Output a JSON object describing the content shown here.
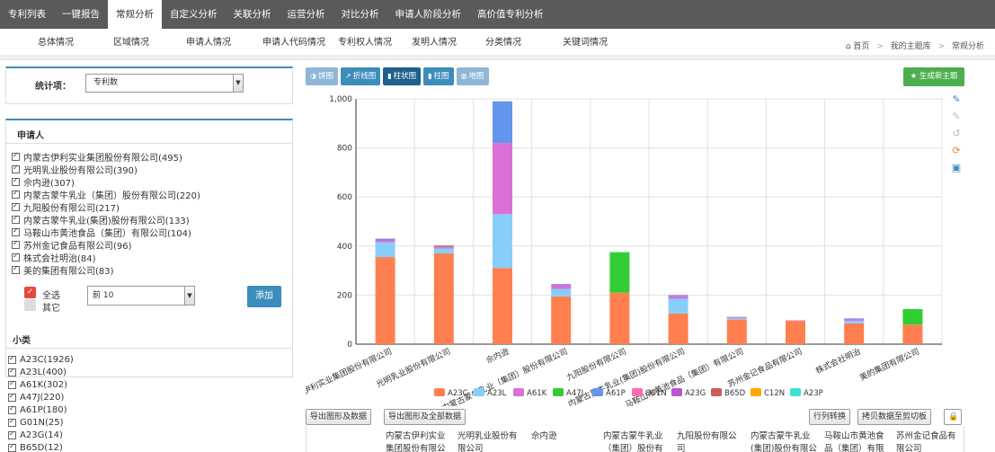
{
  "topnav": {
    "tabs": [
      {
        "label": "专利列表"
      },
      {
        "label": "一键报告"
      },
      {
        "label": "常规分析",
        "active": true
      },
      {
        "label": "自定义分析"
      },
      {
        "label": "关联分析"
      },
      {
        "label": "运营分析"
      },
      {
        "label": "对比分析"
      },
      {
        "label": "申请人阶段分析"
      },
      {
        "label": "高价值专利分析"
      }
    ]
  },
  "subnav": {
    "items": [
      "总体情况",
      "区域情况",
      "申请人情况",
      "申请人代码情况",
      "专利权人情况",
      "发明人情况",
      "分类情况",
      "关键词情况"
    ]
  },
  "breadcrumb": {
    "home": "首页",
    "library": "我的主题库",
    "current": "常规分析"
  },
  "left": {
    "stat_label": "统计项：",
    "stat_value": "专利数",
    "applicant_title": "申请人",
    "applicants": [
      "内蒙古伊利实业集团股份有限公司(495)",
      "光明乳业股份有限公司(390)",
      "佘内逊(307)",
      "内蒙古蒙牛乳业（集团）股份有限公司(220)",
      "九阳股份有限公司(217)",
      "内蒙古蒙牛乳业(集团)股份有限公司(133)",
      "马鞍山市黄池食品（集团）有限公司(104)",
      "苏州金记食品有限公司(96)",
      "株式会社明治(84)",
      "美的集团有限公司(83)"
    ],
    "select_all": "全选",
    "others": "其它",
    "top_n": "前 10",
    "add_button": "添加",
    "subclass_title": "小类",
    "subclasses": [
      "A23C(1926)",
      "A23L(400)",
      "A61K(302)",
      "A47J(220)",
      "A61P(180)",
      "G01N(25)",
      "A23G(14)",
      "B65D(12)"
    ]
  },
  "toolbar": {
    "buttons": [
      {
        "label": "饼图",
        "icon": "pie-icon",
        "style": "light"
      },
      {
        "label": "折线图",
        "icon": "line-icon",
        "style": "mid"
      },
      {
        "label": "柱状图",
        "icon": "bar-icon",
        "style": "dark"
      },
      {
        "label": "柱图",
        "icon": "column-icon",
        "style": "mid"
      },
      {
        "label": "地图",
        "icon": "globe-icon",
        "style": "light"
      }
    ],
    "generate": "生成新主题"
  },
  "chart_data": {
    "type": "bar",
    "stacked": true,
    "ylim": [
      0,
      1000
    ],
    "yticks": [
      "0",
      "200",
      "400",
      "600",
      "800",
      "1,000"
    ],
    "grid": true,
    "legend_position": "bottom",
    "categories": [
      "内蒙古伊利实业集团股份有限公司",
      "光明乳业股份有限公司",
      "佘内逊",
      "内蒙古蒙牛乳业（集团）股份有限公司",
      "九阳股份有限公司",
      "内蒙古蒙牛乳业(集团)股份有限公司",
      "马鞍山市黄池食品（集团）有限公司",
      "苏州金记食品有限公司",
      "株式会社明治",
      "美的集团有限公司"
    ],
    "series": [
      {
        "name": "A23C",
        "color": "#ff7f50",
        "values": [
          355,
          370,
          310,
          195,
          210,
          125,
          100,
          95,
          85,
          80
        ]
      },
      {
        "name": "A23L",
        "color": "#87cefa",
        "values": [
          60,
          20,
          220,
          30,
          0,
          60,
          5,
          0,
          10,
          0
        ]
      },
      {
        "name": "A61K",
        "color": "#da70d6",
        "values": [
          8,
          5,
          290,
          15,
          0,
          10,
          2,
          2,
          5,
          0
        ]
      },
      {
        "name": "A47J",
        "color": "#32cd32",
        "values": [
          0,
          0,
          0,
          0,
          165,
          0,
          0,
          0,
          0,
          63
        ]
      },
      {
        "name": "A61P",
        "color": "#6495ed",
        "values": [
          4,
          2,
          170,
          3,
          0,
          3,
          2,
          0,
          3,
          0
        ]
      },
      {
        "name": "G01N",
        "color": "#ff69b4",
        "values": [
          0,
          0,
          0,
          0,
          0,
          0,
          0,
          0,
          0,
          0
        ]
      },
      {
        "name": "A23G",
        "color": "#ba55d3",
        "values": [
          3,
          0,
          0,
          2,
          0,
          2,
          0,
          0,
          2,
          0
        ]
      },
      {
        "name": "B65D",
        "color": "#cd5c5c",
        "values": [
          0,
          5,
          0,
          0,
          0,
          0,
          2,
          0,
          0,
          0
        ]
      },
      {
        "name": "C12N",
        "color": "#ffa500",
        "values": [
          0,
          0,
          0,
          0,
          0,
          0,
          0,
          0,
          0,
          0
        ]
      },
      {
        "name": "A23P",
        "color": "#40e0d0",
        "values": [
          0,
          0,
          0,
          0,
          0,
          0,
          0,
          0,
          0,
          0
        ]
      }
    ]
  },
  "bottom": {
    "export_chart": "导出图形及数据",
    "export_all": "导出图形及全部数据",
    "transpose": "行列转换",
    "copy": "拷贝数据至剪切板",
    "table_headers": [
      "内蒙古伊利实业集团股份有限公司",
      "光明乳业股份有限公司",
      "佘内逊",
      "内蒙古蒙牛乳业（集团）股份有限公司",
      "九阳股份有限公司",
      "内蒙古蒙牛乳业(集团)股份有限公司",
      "马鞍山市黄池食品（集团）有限公司",
      "苏州金记食品有限公司"
    ]
  },
  "colors": {
    "accent": "#3c8dbc",
    "nav_bg": "#5a5a5a",
    "green": "#4cae4c"
  }
}
